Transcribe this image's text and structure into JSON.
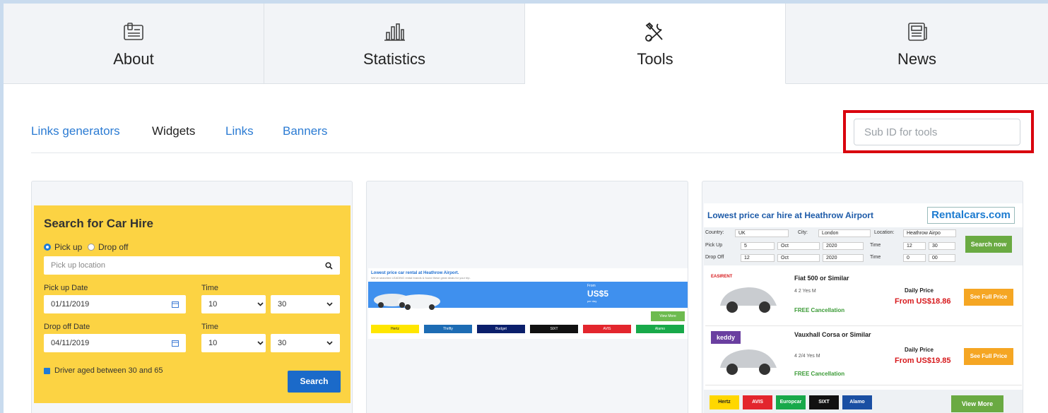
{
  "tabs": [
    {
      "label": "About",
      "icon": "document-icon"
    },
    {
      "label": "Statistics",
      "icon": "bar-chart-icon"
    },
    {
      "label": "Tools",
      "icon": "tools-icon",
      "active": true
    },
    {
      "label": "News",
      "icon": "newspaper-icon"
    }
  ],
  "subnav": {
    "links_generators": "Links generators",
    "widgets": "Widgets",
    "links": "Links",
    "banners": "Banners"
  },
  "subid": {
    "placeholder": "Sub ID for tools",
    "value": ""
  },
  "widget1": {
    "title": "Search for Car Hire",
    "pickup_radio": "Pick up",
    "dropoff_radio": "Drop off",
    "location_placeholder": "Pick up location",
    "pickup_date_label": "Pick up Date",
    "pickup_date": "01/11/2019",
    "time_label": "Time",
    "pickup_hour": "10",
    "pickup_min": "30",
    "dropoff_date_label": "Drop off Date",
    "dropoff_date": "04/11/2019",
    "time_label2": "Time",
    "dropoff_hour": "10",
    "dropoff_min": "30",
    "driver_age": "Driver aged between 30 and 65",
    "search_button": "Search"
  },
  "widget2": {
    "title": "Lowest price car rental at Heathrow Airport.",
    "subtitle": "We've searched LEADING rental brands & found these great deals for your trip.",
    "from": "From",
    "price": "US$5",
    "per_day": "per day",
    "view_more": "View More",
    "brands": [
      "Hertz",
      "Thrifty",
      "Budget",
      "SIXT",
      "AVIS",
      "Alamo"
    ]
  },
  "widget3": {
    "title": "Lowest price car hire at Heathrow Airport",
    "logo": "Rentalcars.com",
    "country_label": "Country:",
    "country": "UK",
    "city_label": "City:",
    "city": "London",
    "location_label": "Location:",
    "location": "Heathrow Airpo",
    "pickup_label": "Pick Up",
    "pickup_day": "5",
    "pickup_month": "Oct",
    "pickup_year": "2020",
    "time_label": "Time",
    "pickup_hour": "12",
    "pickup_min": "30",
    "dropoff_label": "Drop Off",
    "dropoff_day": "12",
    "dropoff_month": "Oct",
    "dropoff_year": "2020",
    "time_label2": "Time",
    "dropoff_hour": "0",
    "dropoff_min": "00",
    "search_now": "Search now",
    "cars": [
      {
        "name": "Fiat 500 or Similar",
        "features": "4   2   Yes   M",
        "daily": "Daily Price",
        "price": "From US$18.86",
        "button": "See Full Price",
        "cancel": "FREE Cancellation",
        "vendor": "EASIRENT"
      },
      {
        "name": "Vauxhall Corsa or Similar",
        "features": "4   2/4   Yes   M",
        "daily": "Daily Price",
        "price": "From US$19.85",
        "button": "See Full Price",
        "cancel": "FREE Cancellation",
        "vendor": "keddy"
      }
    ],
    "footer_brands": [
      "Hertz",
      "AVIS",
      "Europcar",
      "SIXT",
      "Alamo"
    ],
    "view_more": "View More"
  }
}
